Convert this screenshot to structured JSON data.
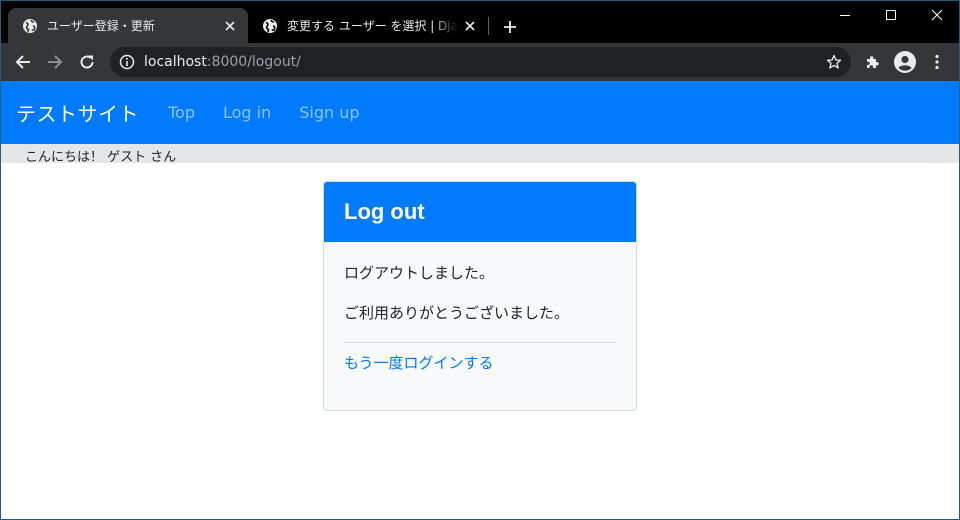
{
  "browser": {
    "tabs": [
      {
        "title": "ユーザー登録・更新",
        "active": true
      },
      {
        "title": "変更する ユーザー を選択 | Django サイト管理",
        "active": false
      }
    ],
    "address": {
      "host": "localhost",
      "path": ":8000/logout/"
    },
    "icons": {
      "tab_favicon": "globe-icon",
      "tab_close": "close-icon",
      "new_tab": "plus-icon",
      "back": "back-arrow-icon",
      "forward": "forward-arrow-icon",
      "reload": "reload-icon",
      "site_info": "info-icon",
      "bookmark": "star-icon",
      "extensions": "puzzle-icon",
      "profile": "avatar-icon",
      "menu": "kebab-menu-icon"
    }
  },
  "site": {
    "brand": "テストサイト",
    "nav": [
      "Top",
      "Log in",
      "Sign up"
    ],
    "greeting": "こんにちは！ ゲスト さん"
  },
  "card": {
    "title": "Log out",
    "message": "ログアウトしました。",
    "thanks": "ご利用ありがとうございました。",
    "login_again": "もう一度ログインする"
  },
  "colors": {
    "primary": "#007bff",
    "chrome_dark": "#35363a",
    "tabstrip": "#000000",
    "omnibox": "#202124",
    "greeting_bar": "#e5e6e8",
    "card_bg": "#f8f9fa"
  }
}
